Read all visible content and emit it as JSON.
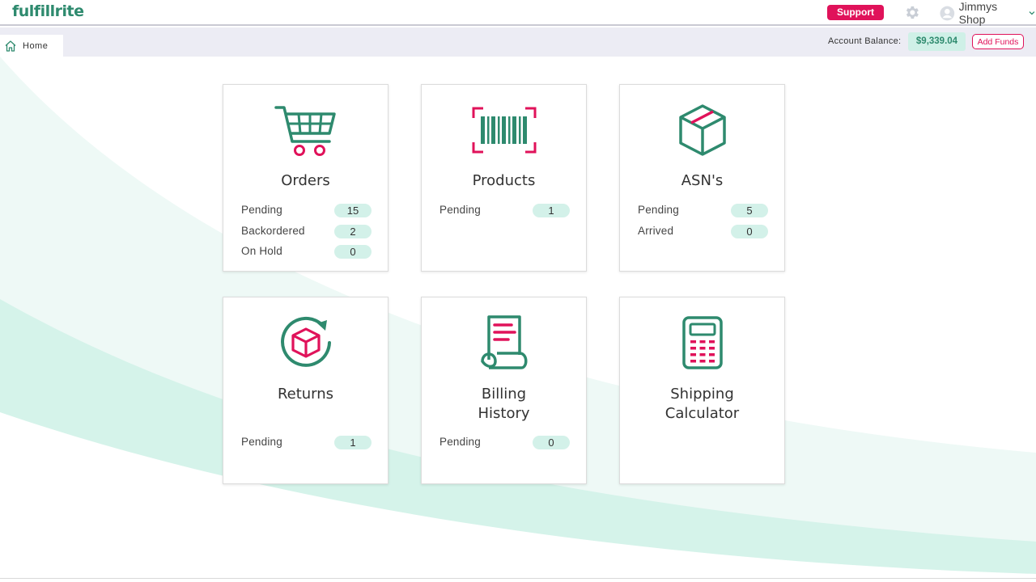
{
  "header": {
    "logo_text": "fulfillrite",
    "support_label": "Support",
    "user_name": "Jimmys Shop"
  },
  "subbar": {
    "home_tab": "Home",
    "balance_label": "Account Balance:",
    "balance_value": "$9,339.04",
    "add_funds_label": "Add Funds"
  },
  "colors": {
    "brand_green": "#2e8a6e",
    "accent_pink": "#e0125a",
    "pill_bg": "#d3f1e9",
    "wave_light": "#e6f7f2"
  },
  "cards": {
    "orders": {
      "title": "Orders",
      "icon": "shopping-cart-icon",
      "rows": [
        {
          "label": "Pending",
          "value": "15"
        },
        {
          "label": "Backordered",
          "value": "2"
        },
        {
          "label": "On Hold",
          "value": "0"
        }
      ]
    },
    "products": {
      "title": "Products",
      "icon": "barcode-icon",
      "rows": [
        {
          "label": "Pending",
          "value": "1"
        }
      ]
    },
    "asns": {
      "title": "ASN's",
      "icon": "box-icon",
      "rows": [
        {
          "label": "Pending",
          "value": "5"
        },
        {
          "label": "Arrived",
          "value": "0"
        }
      ]
    },
    "returns": {
      "title": "Returns",
      "icon": "return-box-icon",
      "rows": [
        {
          "label": "Pending",
          "value": "1"
        }
      ]
    },
    "billing": {
      "title_line1": "Billing",
      "title_line2": "History",
      "icon": "receipt-icon",
      "rows": [
        {
          "label": "Pending",
          "value": "0"
        }
      ]
    },
    "shipping": {
      "title_line1": "Shipping",
      "title_line2": "Calculator",
      "icon": "calculator-icon"
    }
  }
}
